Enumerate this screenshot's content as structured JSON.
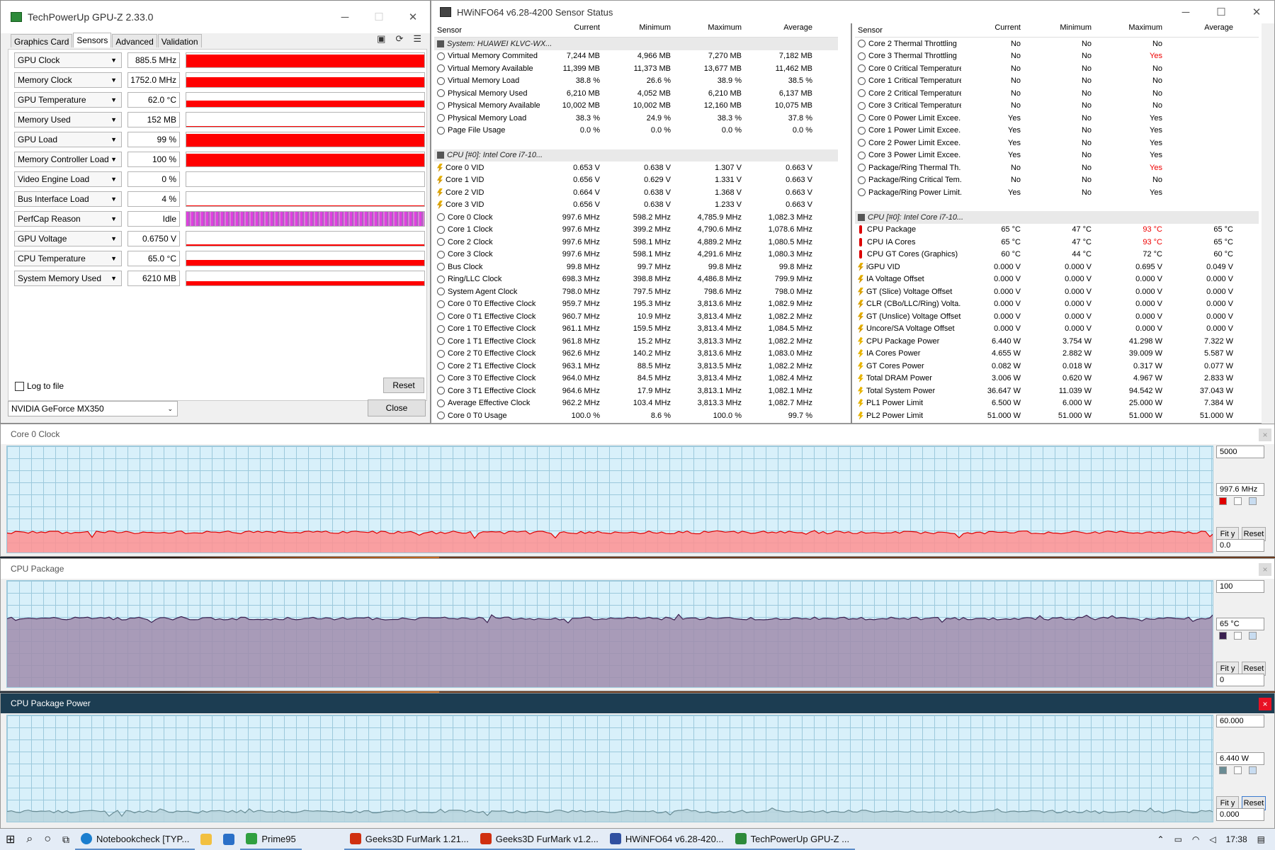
{
  "gpuz": {
    "title": "TechPowerUp GPU-Z 2.33.0",
    "tabs": [
      "Graphics Card",
      "Sensors",
      "Advanced",
      "Validation"
    ],
    "active_tab": "Sensors",
    "sensors": [
      {
        "name": "GPU Clock",
        "value": "885.5 MHz",
        "level": 0.92
      },
      {
        "name": "Memory Clock",
        "value": "1752.0 MHz",
        "level": 0.72
      },
      {
        "name": "GPU Temperature",
        "value": "62.0 °C",
        "level": 0.45
      },
      {
        "name": "Memory Used",
        "value": "152 MB",
        "level": 0.05
      },
      {
        "name": "GPU Load",
        "value": "99 %",
        "level": 0.92
      },
      {
        "name": "Memory Controller Load",
        "value": "100 %",
        "level": 0.92
      },
      {
        "name": "Video Engine Load",
        "value": "0 %",
        "level": 0
      },
      {
        "name": "Bus Interface Load",
        "value": "4 %",
        "level": 0.04
      },
      {
        "name": "PerfCap Reason",
        "value": "Idle",
        "level": 0.7
      },
      {
        "name": "GPU Voltage",
        "value": "0.6750 V",
        "level": 0.1
      },
      {
        "name": "CPU Temperature",
        "value": "65.0 °C",
        "level": 0.4
      },
      {
        "name": "System Memory Used",
        "value": "6210 MB",
        "level": 0.3
      }
    ],
    "log_to_file": "Log to file",
    "reset": "Reset",
    "gpu_select": "NVIDIA GeForce MX350",
    "close": "Close"
  },
  "hwinfo": {
    "title": "HWiNFO64 v6.28-4200 Sensor Status",
    "headers": [
      "Sensor",
      "Current",
      "Minimum",
      "Maximum",
      "Average"
    ],
    "left": [
      {
        "t": "group",
        "n": "System: HUAWEI KLVC-WX..."
      },
      {
        "n": "Virtual Memory Commited",
        "v": [
          "7,244 MB",
          "4,966 MB",
          "7,270 MB",
          "7,182 MB"
        ]
      },
      {
        "n": "Virtual Memory Available",
        "v": [
          "11,399 MB",
          "11,373 MB",
          "13,677 MB",
          "11,462 MB"
        ]
      },
      {
        "n": "Virtual Memory Load",
        "v": [
          "38.8 %",
          "26.6 %",
          "38.9 %",
          "38.5 %"
        ]
      },
      {
        "n": "Physical Memory Used",
        "v": [
          "6,210 MB",
          "4,052 MB",
          "6,210 MB",
          "6,137 MB"
        ]
      },
      {
        "n": "Physical Memory Available",
        "v": [
          "10,002 MB",
          "10,002 MB",
          "12,160 MB",
          "10,075 MB"
        ]
      },
      {
        "n": "Physical Memory Load",
        "v": [
          "38.3 %",
          "24.9 %",
          "38.3 %",
          "37.8 %"
        ]
      },
      {
        "n": "Page File Usage",
        "v": [
          "0.0 %",
          "0.0 %",
          "0.0 %",
          "0.0 %"
        ]
      },
      {
        "t": "blank"
      },
      {
        "t": "group",
        "n": "CPU [#0]: Intel Core i7-10..."
      },
      {
        "i": "volt",
        "n": "Core 0 VID",
        "v": [
          "0.653 V",
          "0.638 V",
          "1.307 V",
          "0.663 V"
        ]
      },
      {
        "i": "volt",
        "n": "Core 1 VID",
        "v": [
          "0.656 V",
          "0.629 V",
          "1.331 V",
          "0.663 V"
        ]
      },
      {
        "i": "volt",
        "n": "Core 2 VID",
        "v": [
          "0.664 V",
          "0.638 V",
          "1.368 V",
          "0.663 V"
        ]
      },
      {
        "i": "volt",
        "n": "Core 3 VID",
        "v": [
          "0.656 V",
          "0.638 V",
          "1.233 V",
          "0.663 V"
        ]
      },
      {
        "n": "Core 0 Clock",
        "v": [
          "997.6 MHz",
          "598.2 MHz",
          "4,785.9 MHz",
          "1,082.3 MHz"
        ]
      },
      {
        "n": "Core 1 Clock",
        "v": [
          "997.6 MHz",
          "399.2 MHz",
          "4,790.6 MHz",
          "1,078.6 MHz"
        ]
      },
      {
        "n": "Core 2 Clock",
        "v": [
          "997.6 MHz",
          "598.1 MHz",
          "4,889.2 MHz",
          "1,080.5 MHz"
        ]
      },
      {
        "n": "Core 3 Clock",
        "v": [
          "997.6 MHz",
          "598.1 MHz",
          "4,291.6 MHz",
          "1,080.3 MHz"
        ]
      },
      {
        "n": "Bus Clock",
        "v": [
          "99.8 MHz",
          "99.7 MHz",
          "99.8 MHz",
          "99.8 MHz"
        ]
      },
      {
        "n": "Ring/LLC Clock",
        "v": [
          "698.3 MHz",
          "398.8 MHz",
          "4,486.8 MHz",
          "799.9 MHz"
        ]
      },
      {
        "n": "System Agent Clock",
        "v": [
          "798.0 MHz",
          "797.5 MHz",
          "798.6 MHz",
          "798.0 MHz"
        ]
      },
      {
        "n": "Core 0 T0 Effective Clock",
        "v": [
          "959.7 MHz",
          "195.3 MHz",
          "3,813.6 MHz",
          "1,082.9 MHz"
        ]
      },
      {
        "n": "Core 0 T1 Effective Clock",
        "v": [
          "960.7 MHz",
          "10.9 MHz",
          "3,813.4 MHz",
          "1,082.2 MHz"
        ]
      },
      {
        "n": "Core 1 T0 Effective Clock",
        "v": [
          "961.1 MHz",
          "159.5 MHz",
          "3,813.4 MHz",
          "1,084.5 MHz"
        ]
      },
      {
        "n": "Core 1 T1 Effective Clock",
        "v": [
          "961.8 MHz",
          "15.2 MHz",
          "3,813.3 MHz",
          "1,082.2 MHz"
        ]
      },
      {
        "n": "Core 2 T0 Effective Clock",
        "v": [
          "962.6 MHz",
          "140.2 MHz",
          "3,813.6 MHz",
          "1,083.0 MHz"
        ]
      },
      {
        "n": "Core 2 T1 Effective Clock",
        "v": [
          "963.1 MHz",
          "88.5 MHz",
          "3,813.5 MHz",
          "1,082.2 MHz"
        ]
      },
      {
        "n": "Core 3 T0 Effective Clock",
        "v": [
          "964.0 MHz",
          "84.5 MHz",
          "3,813.4 MHz",
          "1,082.4 MHz"
        ]
      },
      {
        "n": "Core 3 T1 Effective Clock",
        "v": [
          "964.6 MHz",
          "17.9 MHz",
          "3,813.1 MHz",
          "1,082.1 MHz"
        ]
      },
      {
        "n": "Average Effective Clock",
        "v": [
          "962.2 MHz",
          "103.4 MHz",
          "3,813.3 MHz",
          "1,082.7 MHz"
        ]
      },
      {
        "n": "Core 0 T0 Usage",
        "v": [
          "100.0 %",
          "8.6 %",
          "100.0 %",
          "99.7 %"
        ]
      }
    ],
    "right": [
      {
        "n": "Core 2 Thermal Throttling",
        "v": [
          "No",
          "No",
          "No",
          ""
        ]
      },
      {
        "n": "Core 3 Thermal Throttling",
        "v": [
          "No",
          "No",
          "Yes",
          ""
        ],
        "r": [
          2
        ]
      },
      {
        "n": "Core 0 Critical Temperature",
        "v": [
          "No",
          "No",
          "No",
          ""
        ]
      },
      {
        "n": "Core 1 Critical Temperature",
        "v": [
          "No",
          "No",
          "No",
          ""
        ]
      },
      {
        "n": "Core 2 Critical Temperature",
        "v": [
          "No",
          "No",
          "No",
          ""
        ]
      },
      {
        "n": "Core 3 Critical Temperature",
        "v": [
          "No",
          "No",
          "No",
          ""
        ]
      },
      {
        "n": "Core 0 Power Limit Excee...",
        "v": [
          "Yes",
          "No",
          "Yes",
          ""
        ]
      },
      {
        "n": "Core 1 Power Limit Excee...",
        "v": [
          "Yes",
          "No",
          "Yes",
          ""
        ]
      },
      {
        "n": "Core 2 Power Limit Excee...",
        "v": [
          "Yes",
          "No",
          "Yes",
          ""
        ]
      },
      {
        "n": "Core 3 Power Limit Excee...",
        "v": [
          "Yes",
          "No",
          "Yes",
          ""
        ]
      },
      {
        "n": "Package/Ring Thermal Th...",
        "v": [
          "No",
          "No",
          "Yes",
          ""
        ],
        "r": [
          2
        ]
      },
      {
        "n": "Package/Ring Critical Tem...",
        "v": [
          "No",
          "No",
          "No",
          ""
        ]
      },
      {
        "n": "Package/Ring Power Limit...",
        "v": [
          "Yes",
          "No",
          "Yes",
          ""
        ]
      },
      {
        "t": "blank"
      },
      {
        "t": "group",
        "n": "CPU [#0]: Intel Core i7-10..."
      },
      {
        "i": "temp",
        "n": "CPU Package",
        "v": [
          "65 °C",
          "47 °C",
          "93 °C",
          "65 °C"
        ],
        "r": [
          2
        ]
      },
      {
        "i": "temp",
        "n": "CPU IA Cores",
        "v": [
          "65 °C",
          "47 °C",
          "93 °C",
          "65 °C"
        ],
        "r": [
          2
        ]
      },
      {
        "i": "temp",
        "n": "CPU GT Cores (Graphics)",
        "v": [
          "60 °C",
          "44 °C",
          "72 °C",
          "60 °C"
        ]
      },
      {
        "i": "volt",
        "n": "iGPU VID",
        "v": [
          "0.000 V",
          "0.000 V",
          "0.695 V",
          "0.049 V"
        ]
      },
      {
        "i": "volt",
        "n": "IA Voltage Offset",
        "v": [
          "0.000 V",
          "0.000 V",
          "0.000 V",
          "0.000 V"
        ]
      },
      {
        "i": "volt",
        "n": "GT (Slice) Voltage Offset",
        "v": [
          "0.000 V",
          "0.000 V",
          "0.000 V",
          "0.000 V"
        ]
      },
      {
        "i": "volt",
        "n": "CLR (CBo/LLC/Ring) Volta...",
        "v": [
          "0.000 V",
          "0.000 V",
          "0.000 V",
          "0.000 V"
        ]
      },
      {
        "i": "volt",
        "n": "GT (Unslice) Voltage Offset",
        "v": [
          "0.000 V",
          "0.000 V",
          "0.000 V",
          "0.000 V"
        ]
      },
      {
        "i": "volt",
        "n": "Uncore/SA Voltage Offset",
        "v": [
          "0.000 V",
          "0.000 V",
          "0.000 V",
          "0.000 V"
        ]
      },
      {
        "i": "pow",
        "n": "CPU Package Power",
        "v": [
          "6.440 W",
          "3.754 W",
          "41.298 W",
          "7.322 W"
        ]
      },
      {
        "i": "pow",
        "n": "IA Cores Power",
        "v": [
          "4.655 W",
          "2.882 W",
          "39.009 W",
          "5.587 W"
        ]
      },
      {
        "i": "pow",
        "n": "GT Cores Power",
        "v": [
          "0.082 W",
          "0.018 W",
          "0.317 W",
          "0.077 W"
        ]
      },
      {
        "i": "pow",
        "n": "Total DRAM Power",
        "v": [
          "3.006 W",
          "0.620 W",
          "4.967 W",
          "2.833 W"
        ]
      },
      {
        "i": "pow",
        "n": "Total System Power",
        "v": [
          "36.647 W",
          "11.039 W",
          "94.542 W",
          "37.043 W"
        ]
      },
      {
        "i": "pow",
        "n": "PL1 Power Limit",
        "v": [
          "6.500 W",
          "6.000 W",
          "25.000 W",
          "7.384 W"
        ]
      },
      {
        "i": "pow",
        "n": "PL2 Power Limit",
        "v": [
          "51.000 W",
          "51.000 W",
          "51.000 W",
          "51.000 W"
        ]
      }
    ]
  },
  "graphs": [
    {
      "title": "Core 0 Clock",
      "max": "5000",
      "current": "997.6 MHz",
      "min": "0.0",
      "fit": "Fit y",
      "reset": "Reset",
      "color": "#ff9090",
      "line": "#e00000",
      "level": 0.2,
      "dark": false
    },
    {
      "title": "CPU Package",
      "max": "100",
      "current": "65 °C",
      "min": "0",
      "fit": "Fit y",
      "reset": "Reset",
      "color": "#a08cac",
      "line": "#3a2050",
      "level": 0.65,
      "dark": false
    },
    {
      "title": "CPU Package Power",
      "max": "60.000",
      "current": "6.440 W",
      "min": "0.000",
      "fit": "Fit y",
      "reset": "Reset",
      "color": "#b8d4dc",
      "line": "#6a8c94",
      "level": 0.107,
      "dark": true
    }
  ],
  "taskbar": {
    "items": [
      "Notebookcheck [TYP...",
      "Prime95",
      "Geeks3D FurMark 1.21...",
      "Geeks3D FurMark v1.2...",
      "HWiNFO64 v6.28-420...",
      "TechPowerUp GPU-Z ..."
    ],
    "time": "17:38"
  }
}
